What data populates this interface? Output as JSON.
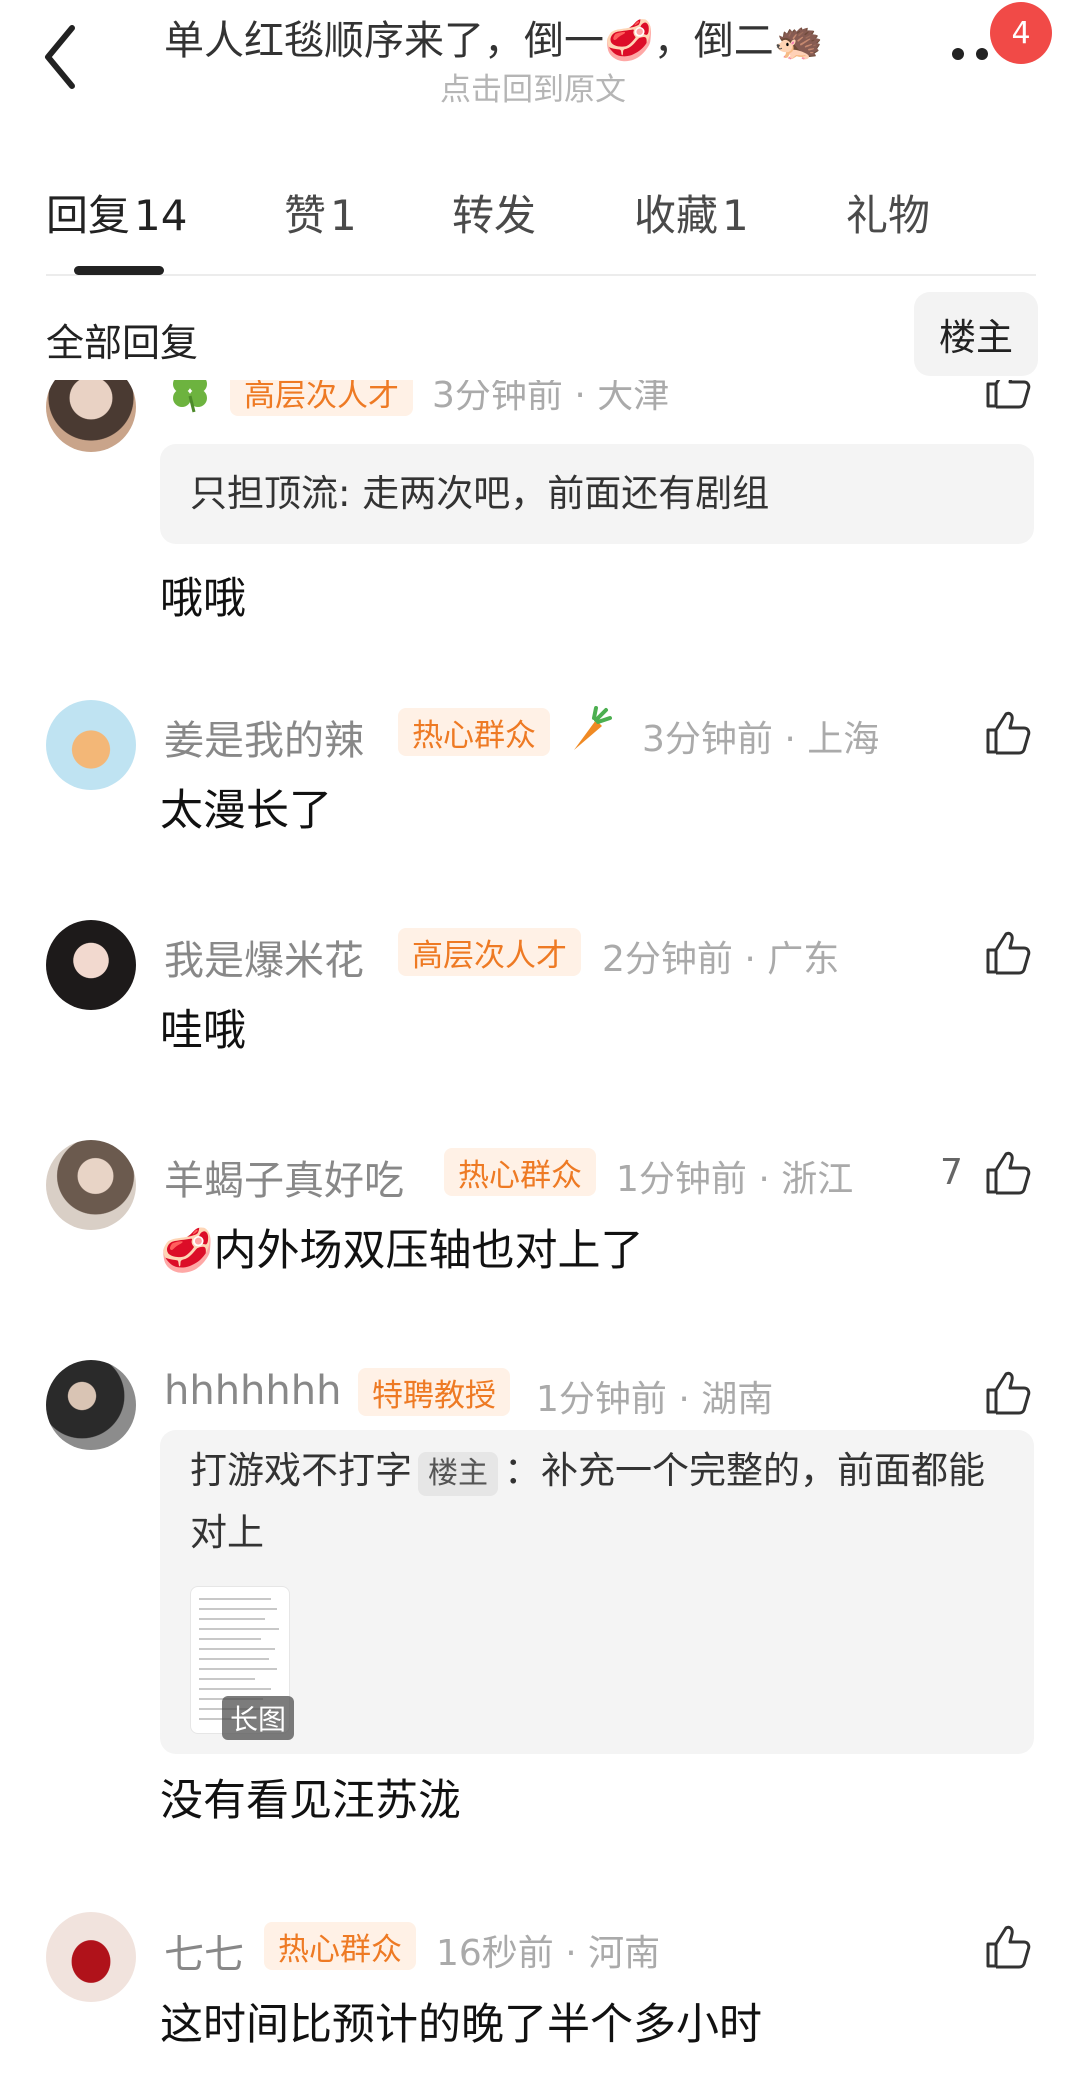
{
  "header": {
    "title": "单人红毯顺序来了，倒一🥩，倒二🦔",
    "subtitle": "点击回到原文",
    "notification_count": "4"
  },
  "tabs": [
    {
      "label": "回复",
      "count": "14"
    },
    {
      "label": "赞",
      "count": "1"
    },
    {
      "label": "转发",
      "count": ""
    },
    {
      "label": "收藏",
      "count": "1"
    },
    {
      "label": "礼物",
      "count": ""
    }
  ],
  "filter": {
    "all_replies": "全部回复",
    "op_only": "楼主"
  },
  "comments": [
    {
      "username": "",
      "badge": "高层次人才",
      "time": "3分钟前",
      "location": "大津",
      "quote_user": "只担顶流",
      "quote_text": ": 走两次吧，前面还有剧组",
      "body": "哦哦",
      "likes": ""
    },
    {
      "username": "姜是我的辣",
      "badge": "热心群众",
      "time": "3分钟前",
      "location": "上海",
      "body": "太漫长了",
      "likes": ""
    },
    {
      "username": "我是爆米花",
      "badge": "高层次人才",
      "time": "2分钟前",
      "location": "广东",
      "body": "哇哦",
      "likes": ""
    },
    {
      "username": "羊蝎子真好吃",
      "badge": "热心群众",
      "time": "1分钟前",
      "location": "浙江",
      "body": "🥩内外场双压轴也对上了",
      "likes": "7"
    },
    {
      "username": "hhhhhhh",
      "badge": "特聘教授",
      "time": "1分钟前",
      "location": "湖南",
      "quote_user": "打游戏不打字",
      "quote_op_tag": "楼主",
      "quote_text": "：补充一个完整的，前面都能对上",
      "quote_image_label": "长图",
      "body": "没有看见汪苏泷",
      "likes": ""
    },
    {
      "username": "七七",
      "badge": "热心群众",
      "time": "16秒前",
      "location": "河南",
      "body": "这时间比预计的晚了半个多小时",
      "likes": ""
    }
  ],
  "meta_separator": "·",
  "colors": {
    "badge_bg": "#fff1e6",
    "badge_text": "#ee7a24",
    "notification": "#f14a47"
  }
}
